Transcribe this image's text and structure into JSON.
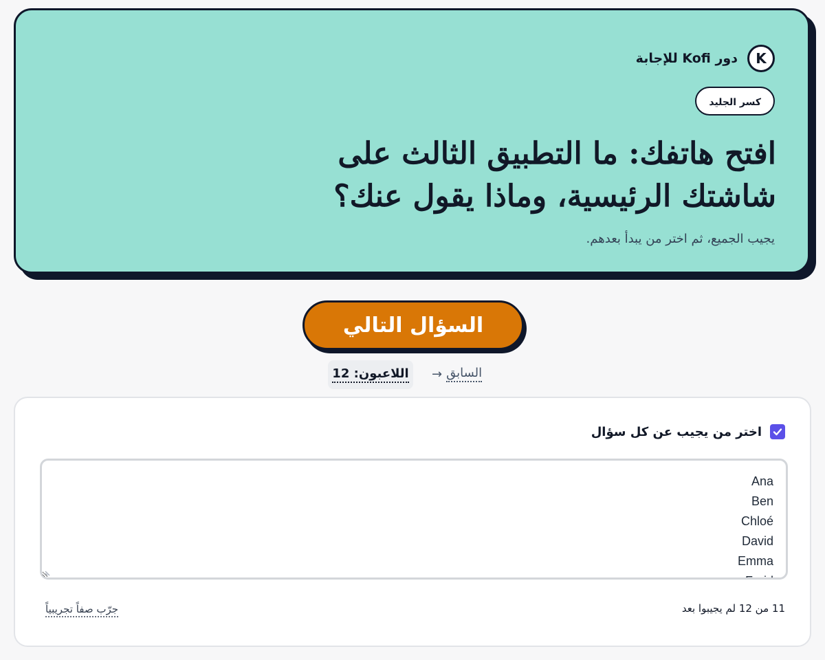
{
  "header": {
    "avatar_letter": "K",
    "turn_text": "دور Kofi للإجابة",
    "category": "كسر الجليد",
    "question_line1": "افتح هاتفك: ما التطبيق الثالث على",
    "question_line2": "شاشتك الرئيسية، وماذا يقول عنك؟",
    "hint": "يجيب الجميع، ثم اختر من يبدأ بعدهم."
  },
  "controls": {
    "next_label": "السؤال التالي",
    "prev_label": "السابق",
    "prev_arrow": "→",
    "players_label": "اللاعبون: 12"
  },
  "panel": {
    "checkbox_checked": true,
    "checkbox_label": "اختر من يجيب عن كل سؤال",
    "names": [
      "Ana",
      "Ben",
      "Chloé",
      "David",
      "Emma",
      "Farid"
    ],
    "remaining": "11 من 12 لم يجيبوا بعد",
    "sample_link": "جرّب صفاً تجريبياً"
  },
  "colors": {
    "card_bg": "#97e0d3",
    "accent": "#d97706",
    "checkbox": "#5b50e8",
    "ink": "#0f172a"
  }
}
